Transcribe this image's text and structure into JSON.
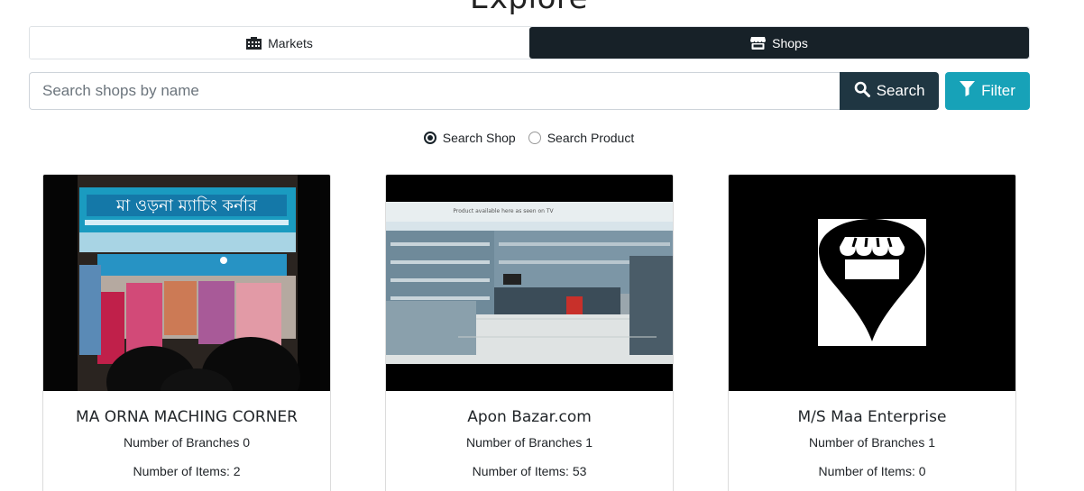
{
  "page": {
    "title": "Explore"
  },
  "tabs": [
    {
      "label": "Markets",
      "icon": "building-icon",
      "active": false
    },
    {
      "label": "Shops",
      "icon": "store-icon",
      "active": true
    }
  ],
  "search": {
    "placeholder": "Search shops by name",
    "value": "",
    "search_label": "Search",
    "filter_label": "Filter"
  },
  "search_mode": {
    "options": [
      {
        "label": "Search Shop",
        "checked": true
      },
      {
        "label": "Search Product",
        "checked": false
      }
    ]
  },
  "shops": [
    {
      "name": "MA ORNA MACHING CORNER",
      "branches": "Number of Branches 0",
      "items": "Number of Items: 2",
      "image": "shop-photo-fabric"
    },
    {
      "name": "Apon Bazar.com",
      "branches": "Number of Branches 1",
      "items": "Number of Items: 53",
      "image": "shop-photo-electronics"
    },
    {
      "name": "M/S Maa Enterprise",
      "branches": "Number of Branches 1",
      "items": "Number of Items: 0",
      "image": "shop-placeholder-icon"
    }
  ],
  "colors": {
    "dark": "#172128",
    "search_button": "#1f3642",
    "filter_button": "#17a2b8"
  }
}
